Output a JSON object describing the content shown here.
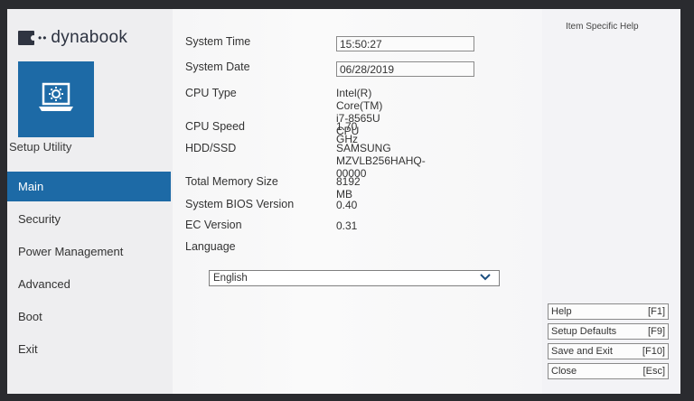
{
  "brand": {
    "name": "dynabook",
    "dots": "••"
  },
  "sidebar": {
    "title": "Setup Utility",
    "items": [
      {
        "label": "Main",
        "active": true
      },
      {
        "label": "Security"
      },
      {
        "label": "Power Management"
      },
      {
        "label": "Advanced"
      },
      {
        "label": "Boot"
      },
      {
        "label": "Exit"
      }
    ]
  },
  "main": {
    "system_time": {
      "label": "System Time",
      "value": "15:50:27"
    },
    "system_date": {
      "label": "System Date",
      "value": "06/28/2019"
    },
    "cpu_type": {
      "label": "CPU Type",
      "value_line1": "Intel(R) Core(TM) i7-8565U",
      "value_line2": "CPU"
    },
    "cpu_speed": {
      "label": "CPU Speed",
      "value": "1.70 GHz"
    },
    "hdd_ssd": {
      "label": "HDD/SSD",
      "value_line1": "SAMSUNG",
      "value_line2": "MZVLB256HAHQ-00000"
    },
    "total_memory": {
      "label": "Total Memory Size",
      "value": "8192 MB"
    },
    "bios_version": {
      "label": "System BIOS Version",
      "value": "0.40"
    },
    "ec_version": {
      "label": "EC Version",
      "value": "0.31"
    },
    "language": {
      "label": "Language",
      "value": "English"
    }
  },
  "help": {
    "title": "Item Specific Help",
    "keys": [
      {
        "label": "Help",
        "key": "[F1]"
      },
      {
        "label": "Setup Defaults",
        "key": "[F9]"
      },
      {
        "label": "Save and Exit",
        "key": "[F10]"
      },
      {
        "label": "Close",
        "key": "[Esc]"
      }
    ]
  },
  "colors": {
    "accent": "#1d6aa6",
    "background": "#f4f4f6"
  },
  "icons": {
    "app_tile": "laptop-gear-icon",
    "language_dropdown": "chevron-down-icon"
  }
}
